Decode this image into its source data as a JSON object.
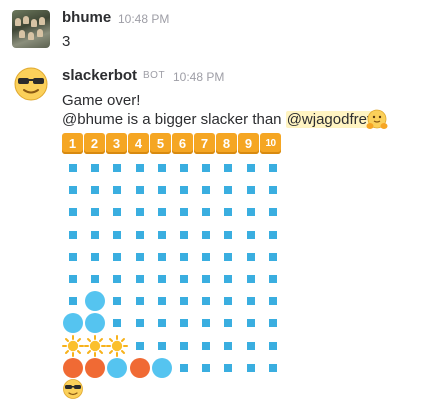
{
  "messages": [
    {
      "user": "bhume",
      "time": "10:48 PM",
      "lines": [
        "3"
      ]
    },
    {
      "user": "slackerbot",
      "badge": "BOT",
      "time": "10:48 PM",
      "line1": "Game over!",
      "line2_prefix": "@bhume is a bigger slacker than ",
      "line2_mention": "@wjagodfrey",
      "line2_suffix": "!"
    }
  ],
  "column_keys": [
    "1",
    "2",
    "3",
    "4",
    "5",
    "6",
    "7",
    "8",
    "9",
    "10"
  ],
  "board": [
    [
      ".",
      ".",
      ".",
      ".",
      ".",
      ".",
      ".",
      ".",
      ".",
      "."
    ],
    [
      ".",
      ".",
      ".",
      ".",
      ".",
      ".",
      ".",
      ".",
      ".",
      "."
    ],
    [
      ".",
      ".",
      ".",
      ".",
      ".",
      ".",
      ".",
      ".",
      ".",
      "."
    ],
    [
      ".",
      ".",
      ".",
      ".",
      ".",
      ".",
      ".",
      ".",
      ".",
      "."
    ],
    [
      ".",
      ".",
      ".",
      ".",
      ".",
      ".",
      ".",
      ".",
      ".",
      "."
    ],
    [
      ".",
      ".",
      ".",
      ".",
      ".",
      ".",
      ".",
      ".",
      ".",
      "."
    ],
    [
      ".",
      "B",
      ".",
      ".",
      ".",
      ".",
      ".",
      ".",
      ".",
      "."
    ],
    [
      "B",
      "B",
      ".",
      ".",
      ".",
      ".",
      ".",
      ".",
      ".",
      "."
    ],
    [
      "S",
      "S",
      "S",
      ".",
      ".",
      ".",
      ".",
      ".",
      ".",
      "."
    ],
    [
      "O",
      "O",
      "B",
      "O",
      "B",
      ".",
      ".",
      ".",
      ".",
      "."
    ]
  ],
  "legend": {
    "B": "blue-piece",
    "O": "orange-piece",
    "S": "sun-icon",
    ".": "empty-slot"
  },
  "colors": {
    "blue": "#55c4f0",
    "orange": "#f06a34",
    "slot": "#3aaee0",
    "key": "#f5a623",
    "mention_bg": "#fff4c2"
  },
  "icons": {
    "user_avatar": "group-photo-avatar",
    "bot_avatar": "sunglasses-face-icon",
    "emoji_after_message": "hugging-face-icon",
    "reaction": "sunglasses-face-icon"
  }
}
